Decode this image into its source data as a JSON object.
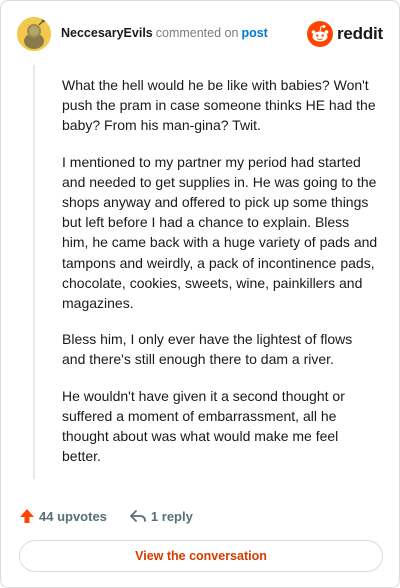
{
  "comment": {
    "username": "NeccesaryEvils",
    "commented_text": "commented on",
    "post_link": "post",
    "paragraphs": [
      "What the hell would he be like with babies? Won't push the pram in case someone thinks HE had the baby? From his man-gina? Twit.",
      "I mentioned to my partner my period had started and needed to get supplies in. He was going to the shops anyway and offered to pick up some things but left before I had a chance to explain. Bless him, he came back with a huge variety of pads and tampons and weirdly, a pack of incontinence pads, chocolate, cookies, sweets, wine, painkillers and magazines.",
      "Bless him, I only ever have the lightest of flows and there's still enough there to dam a river.",
      "He wouldn't have given it a second thought or suffered a moment of embarrassment, all he thought about was what would make me feel better."
    ]
  },
  "brand": {
    "name": "reddit",
    "icon": "reddit-logo-icon",
    "color": "#ff4500"
  },
  "actions": {
    "upvotes": "44 upvotes",
    "replies": "1 reply"
  },
  "cta": {
    "label": "View the conversation"
  },
  "colors": {
    "link": "#0079d3",
    "upvote": "#ff4500",
    "cta_text": "#d93a00"
  }
}
